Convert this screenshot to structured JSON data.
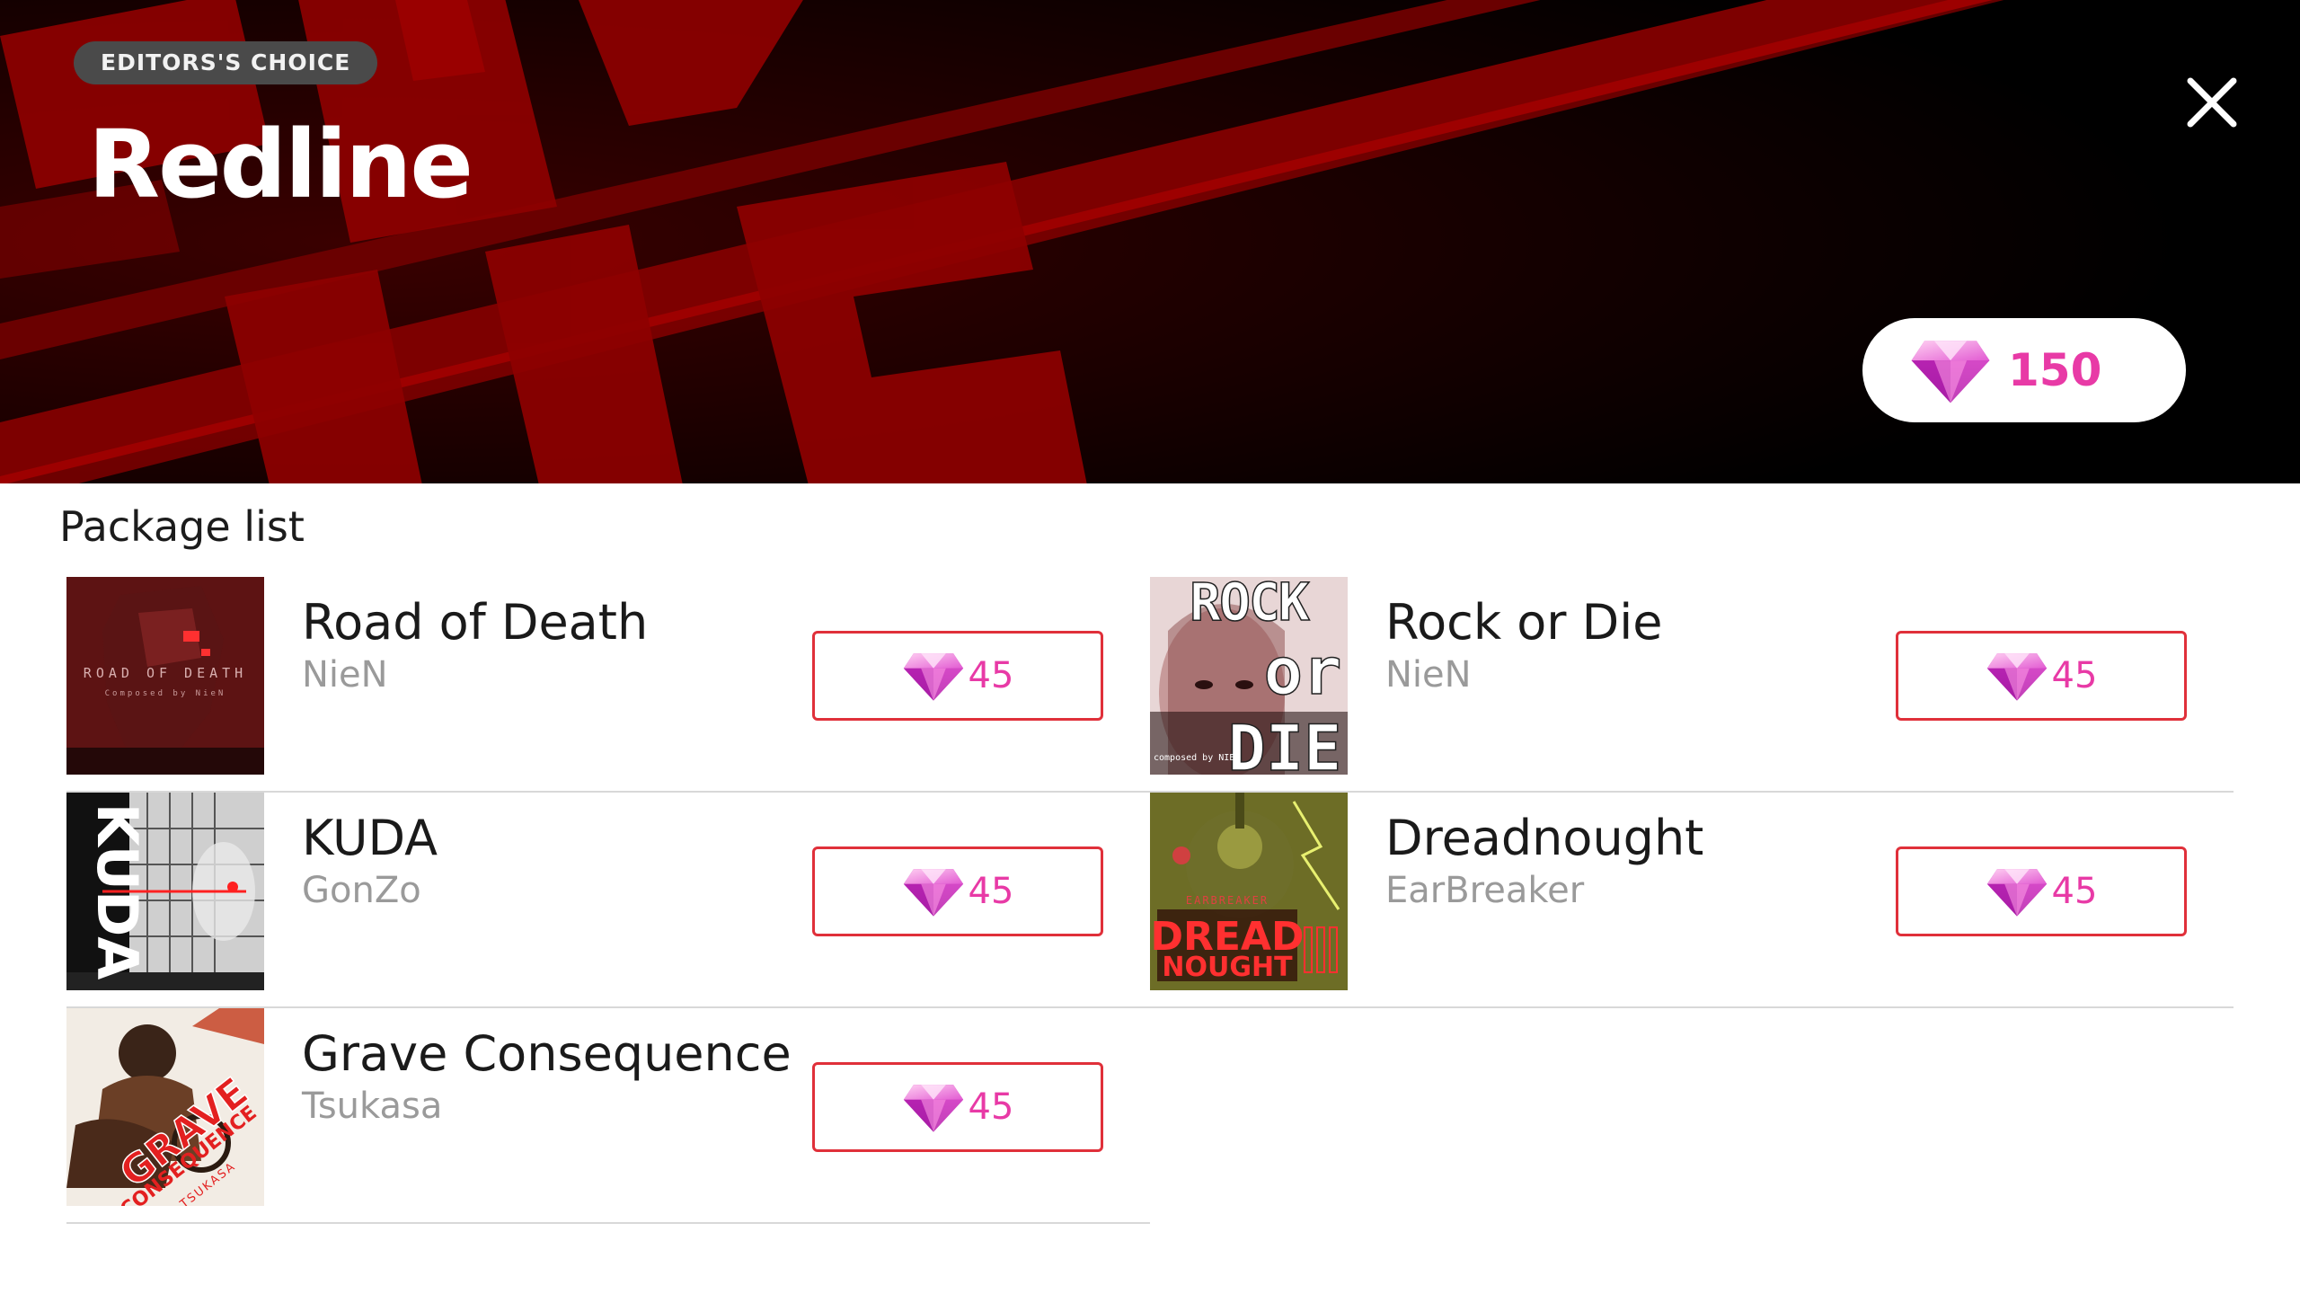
{
  "banner": {
    "badge": "EDITORS'S CHOICE",
    "title": "Redline",
    "package_price": "150"
  },
  "list": {
    "heading": "Package list",
    "items": [
      {
        "title": "Road of Death",
        "artist": "NieN",
        "price": "45",
        "cover_text": "ROAD OF DEATH",
        "cover_sub": "Composed by NieN"
      },
      {
        "title": "Rock or Die",
        "artist": "NieN",
        "price": "45",
        "cover_text": "ROCK",
        "cover_text2": "or",
        "cover_text3": "DIE",
        "cover_sub": "composed by NIEN"
      },
      {
        "title": "KUDA",
        "artist": "GonZo",
        "price": "45",
        "cover_text": "KUDA"
      },
      {
        "title": "Dreadnought",
        "artist": "EarBreaker",
        "price": "45",
        "cover_text": "DREAD",
        "cover_text2": "NOUGHT",
        "cover_sub": "EARBREAKER"
      },
      {
        "title": "Grave Consequence",
        "artist": "Tsukasa",
        "price": "45",
        "cover_text": "GRAVE",
        "cover_text2": "CONSEQUENCE",
        "cover_sub": "TSUKASA"
      }
    ]
  },
  "icons": {
    "close": "close-icon",
    "gem": "gem-icon"
  },
  "colors": {
    "accent_pink": "#e83aa6",
    "button_border": "#e0303a",
    "banner_red": "#8a0000"
  }
}
